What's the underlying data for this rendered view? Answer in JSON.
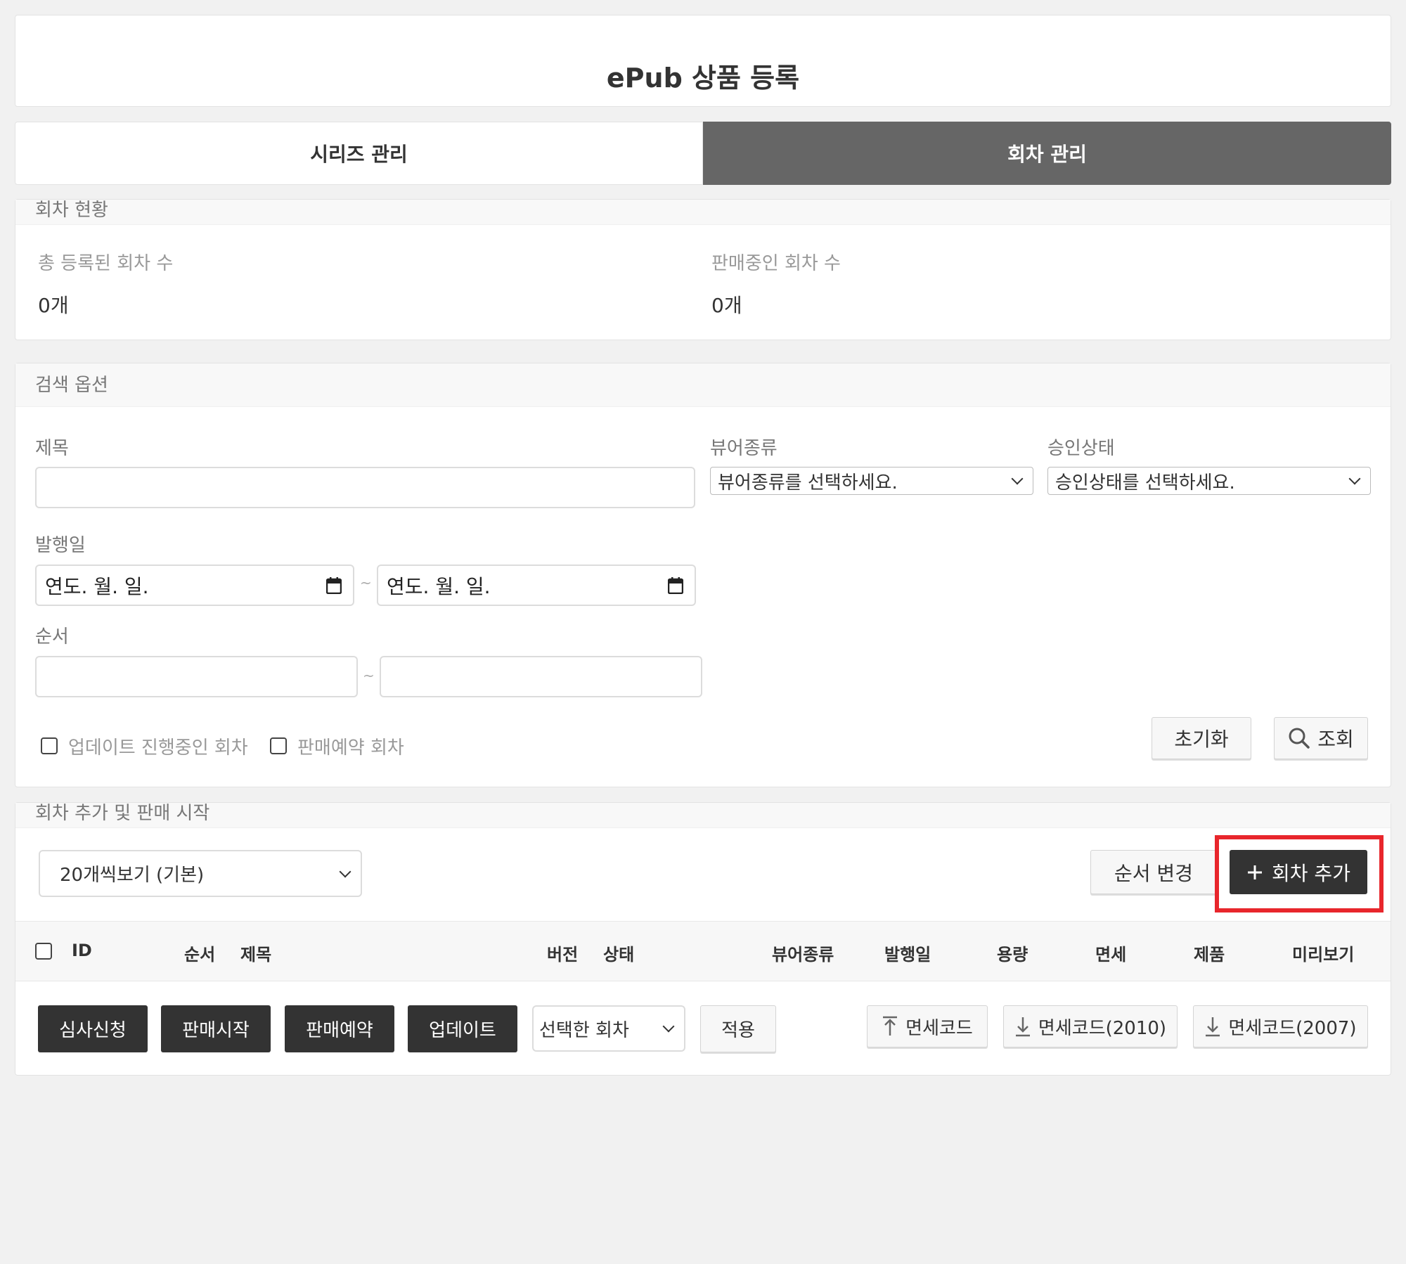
{
  "header": {
    "title": "ePub 상품 등록"
  },
  "tabs": [
    {
      "label": "시리즈 관리",
      "active": false
    },
    {
      "label": "회차 관리",
      "active": true
    }
  ],
  "status": {
    "section_title": "회차 현황",
    "total_label": "총 등록된 회차 수",
    "total_value": "0개",
    "selling_label": "판매중인 회차 수",
    "selling_value": "0개"
  },
  "search": {
    "section_title": "검색 옵션",
    "title_label": "제목",
    "title_value": "",
    "viewer_label": "뷰어종류",
    "viewer_selected": "뷰어종류를 선택하세요.",
    "approval_label": "승인상태",
    "approval_selected": "승인상태를 선택하세요.",
    "pubdate_label": "발행일",
    "date_from": "연도. 월. 일.",
    "date_to": "연도. 월. 일.",
    "range_sep": "~",
    "order_label": "순서",
    "check_updating": "업데이트 진행중인 회차",
    "check_reserved": "판매예약 회차",
    "reset_button": "초기화",
    "search_button": "조회"
  },
  "list": {
    "section_title": "회차 추가 및 판매 시작",
    "page_size_selected": "20개씩보기 (기본)",
    "reorder_button": "순서 변경",
    "add_button": "회차 추가",
    "columns": {
      "id": "ID",
      "order": "순서",
      "title": "제목",
      "version": "버전",
      "state": "상태",
      "viewer": "뷰어종류",
      "pubdate": "발행일",
      "size": "용량",
      "tax": "면세",
      "product": "제품",
      "preview": "미리보기"
    },
    "actions": {
      "review": "심사신청",
      "start_sale": "판매시작",
      "reserve": "판매예약",
      "update": "업데이트",
      "target_selected": "선택한 회차",
      "apply": "적용",
      "upload_tax": "면세코드",
      "download_2010": "면세코드(2010)",
      "download_2007": "면세코드(2007)"
    }
  },
  "colors": {
    "accent_dark": "#333333",
    "tab_active": "#666666",
    "highlight": "#e8262c"
  }
}
